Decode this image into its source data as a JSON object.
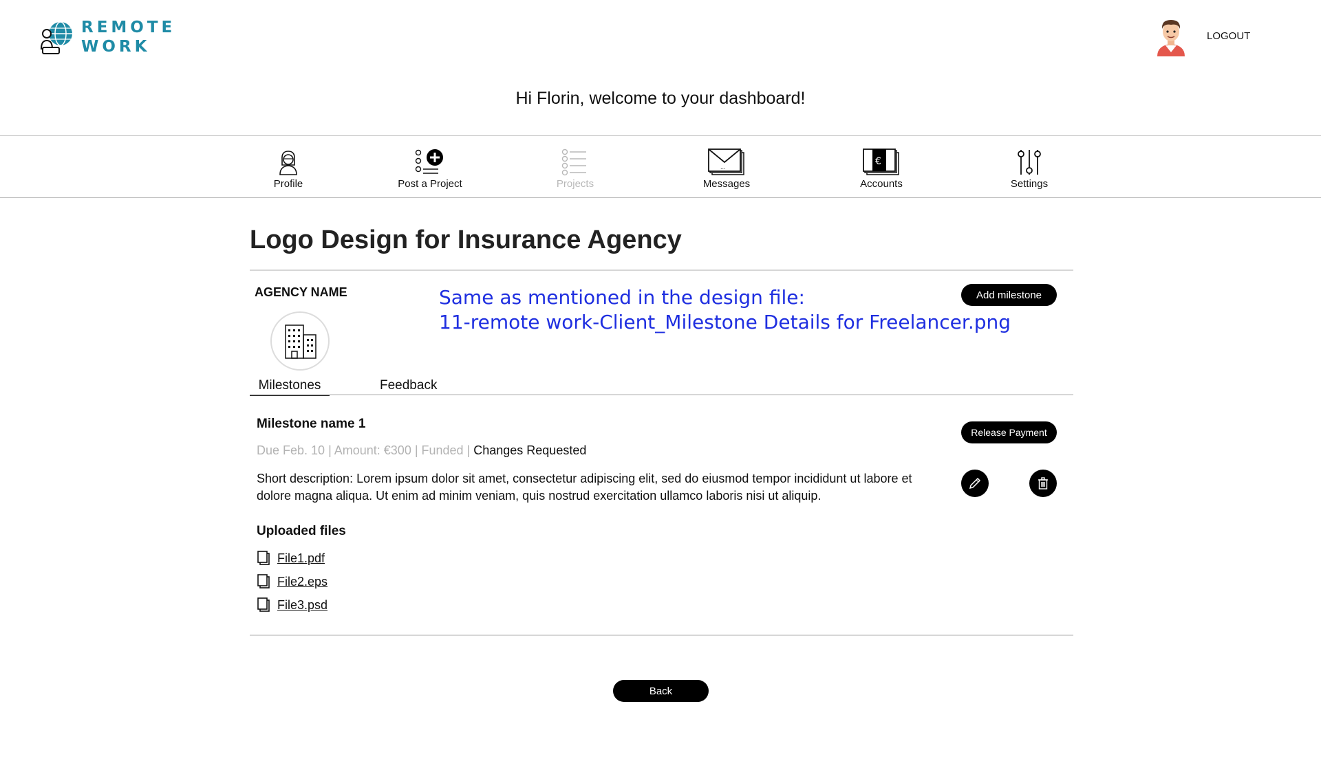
{
  "brand": {
    "line1": "REMOTE",
    "line2": "WORK",
    "color": "#1f8ba6"
  },
  "header": {
    "logout_label": "LOGOUT",
    "welcome": "Hi Florin, welcome to your dashboard!"
  },
  "nav": {
    "profile": "Profile",
    "post_project": "Post a Project",
    "projects": "Projects",
    "messages": "Messages",
    "accounts": "Accounts",
    "settings": "Settings"
  },
  "project": {
    "title": "Logo Design for Insurance Agency",
    "agency_label": "AGENCY NAME",
    "note_line1": "Same as mentioned in the design file:",
    "note_line2": "11-remote work-Client_Milestone Details for Freelancer.png",
    "add_milestone": "Add milestone"
  },
  "tabs": {
    "milestones": "Milestones",
    "feedback": "Feedback"
  },
  "milestone": {
    "name": "Milestone name 1",
    "meta": "Due Feb. 10 | Amount: €300 | Funded | ",
    "status": "Changes Requested",
    "description": "Short description:  Lorem ipsum dolor sit amet, consectetur adipiscing elit, sed do eiusmod tempor incididunt ut labore et dolore magna aliqua. Ut enim ad minim veniam, quis nostrud exercitation ullamco laboris nisi ut aliquip.",
    "release_payment": "Release Payment"
  },
  "files": {
    "title": "Uploaded files",
    "items": [
      "File1.pdf",
      "File2.eps",
      "File3.psd"
    ]
  },
  "footer": {
    "back": "Back"
  },
  "icons": {
    "logo": "globe-person-icon",
    "avatar": "user-avatar",
    "profile": "user-icon",
    "post_project": "checklist-plus-icon",
    "projects": "checklist-icon",
    "messages": "envelope-icon",
    "accounts": "money-icon",
    "settings": "sliders-icon",
    "agency": "building-icon",
    "edit": "pencil-icon",
    "delete": "trash-icon",
    "file": "file-icon"
  }
}
